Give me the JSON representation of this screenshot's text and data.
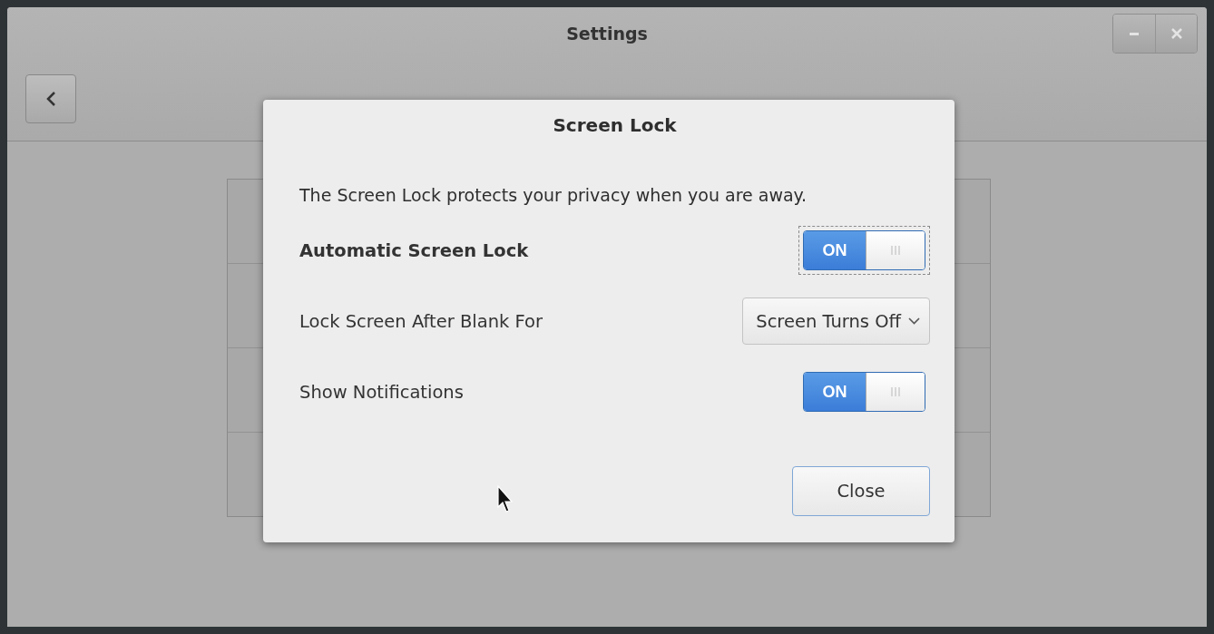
{
  "window": {
    "title": "Settings"
  },
  "dialog": {
    "title": "Screen Lock",
    "description": "The Screen Lock protects your privacy when you are away.",
    "settings": [
      {
        "kind": "switch",
        "label": "Automatic Screen Lock",
        "on": true,
        "focused": true,
        "state_label": "ON"
      },
      {
        "kind": "dropdown",
        "label": "Lock Screen After Blank For",
        "value": "Screen Turns Off"
      },
      {
        "kind": "switch",
        "label": "Show Notifications",
        "on": true,
        "focused": false,
        "state_label": "ON"
      }
    ],
    "buttons": [
      "Close"
    ]
  }
}
